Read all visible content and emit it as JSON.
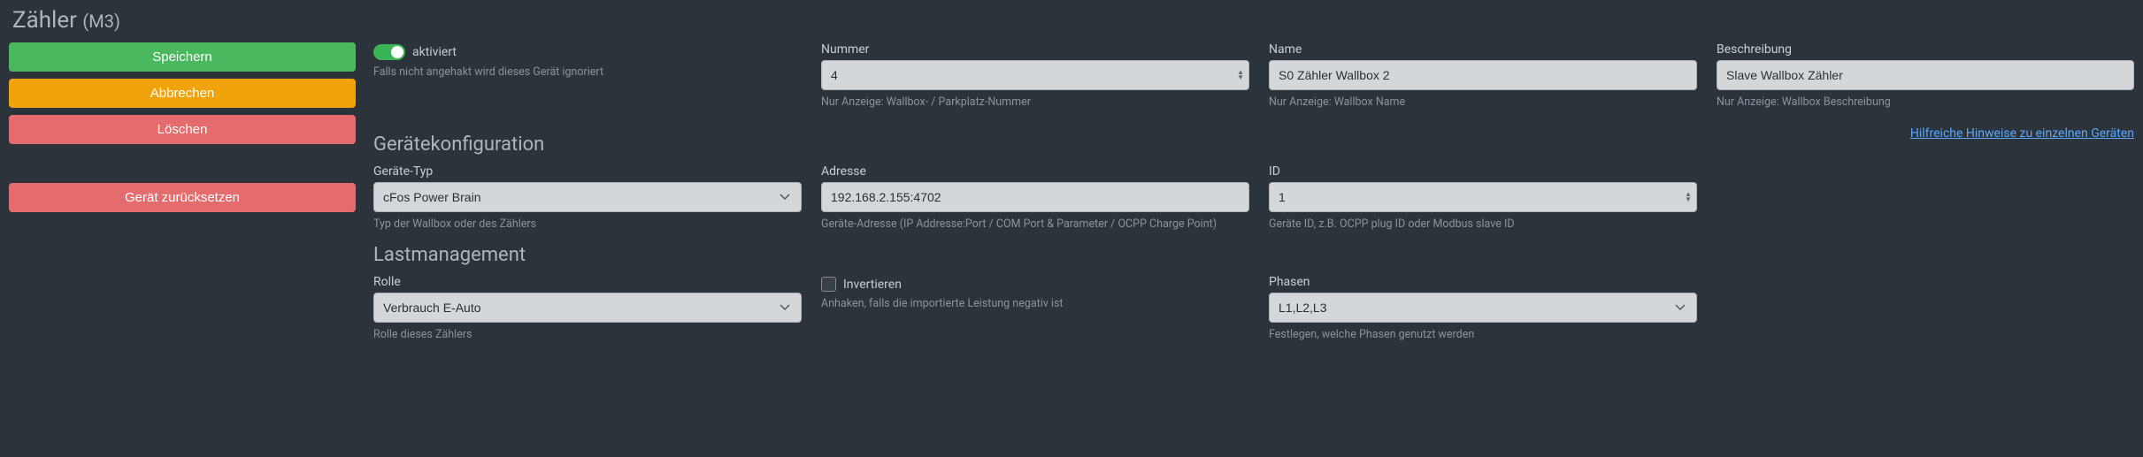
{
  "header": {
    "title": "Zähler",
    "suffix": "(M3)"
  },
  "sidebar": {
    "save": "Speichern",
    "cancel": "Abbrechen",
    "delete": "Löschen",
    "reset": "Gerät zurücksetzen"
  },
  "activation": {
    "toggle_label": "aktiviert",
    "help": "Falls nicht angehakt wird dieses Gerät ignoriert"
  },
  "number": {
    "label": "Nummer",
    "value": "4",
    "help": "Nur Anzeige: Wallbox- / Parkplatz-Nummer"
  },
  "name": {
    "label": "Name",
    "value": "S0 Zähler Wallbox 2",
    "help": "Nur Anzeige: Wallbox Name"
  },
  "description": {
    "label": "Beschreibung",
    "value": "Slave Wallbox Zähler",
    "help": "Nur Anzeige: Wallbox Beschreibung"
  },
  "device_config": {
    "section": "Gerätekonfiguration",
    "hint_link": "Hilfreiche Hinweise zu einzelnen Geräten",
    "type": {
      "label": "Geräte-Typ",
      "value": "cFos Power Brain",
      "help": "Typ der Wallbox oder des Zählers"
    },
    "address": {
      "label": "Adresse",
      "value": "192.168.2.155:4702",
      "help": "Geräte-Adresse (IP Addresse:Port / COM Port & Parameter / OCPP Charge Point)"
    },
    "id": {
      "label": "ID",
      "value": "1",
      "help": "Geräte ID, z.B. OCPP plug ID oder Modbus slave ID"
    }
  },
  "load_mgmt": {
    "section": "Lastmanagement",
    "role": {
      "label": "Rolle",
      "value": "Verbrauch E-Auto",
      "help": "Rolle dieses Zählers"
    },
    "invert": {
      "label": "Invertieren",
      "help": "Anhaken, falls die importierte Leistung negativ ist"
    },
    "phases": {
      "label": "Phasen",
      "value": "L1,L2,L3",
      "help": "Festlegen, welche Phasen genutzt werden"
    }
  }
}
